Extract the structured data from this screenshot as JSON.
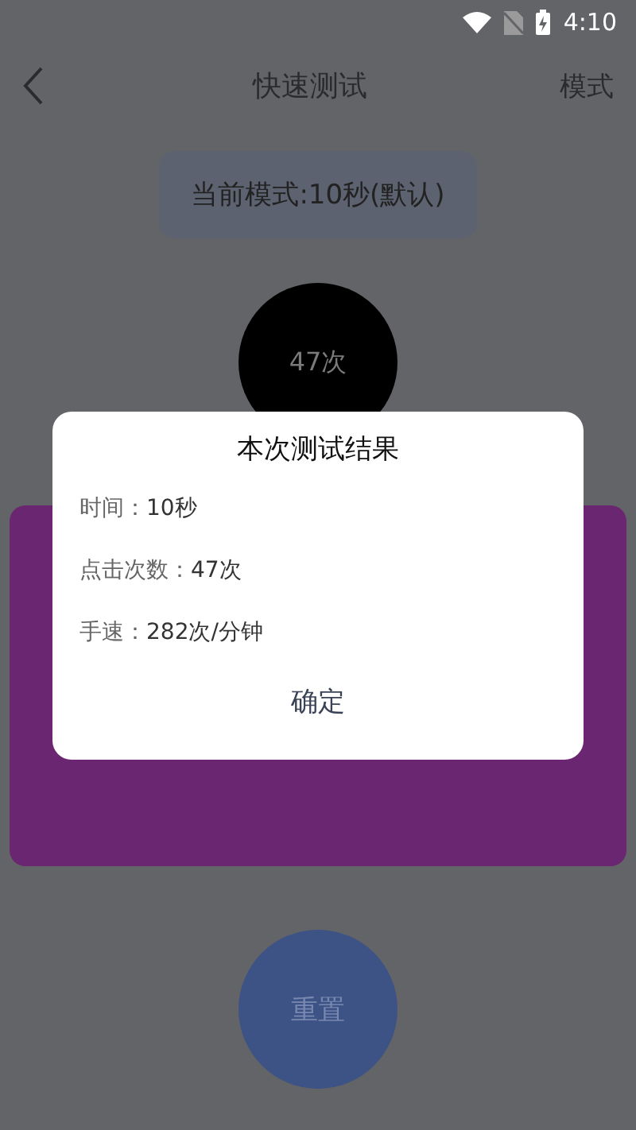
{
  "status_bar": {
    "time": "4:10"
  },
  "nav": {
    "title": "快速测试",
    "action": "模式"
  },
  "mode_label": "当前模式:10秒(默认)",
  "tap_button": {
    "count": "47次"
  },
  "reset_button": "重置",
  "dialog": {
    "title": "本次测试结果",
    "rows": [
      {
        "label": "时间：",
        "value": "10秒"
      },
      {
        "label": "点击次数：",
        "value": "47次"
      },
      {
        "label": "手速：",
        "value": "282次/分钟"
      }
    ],
    "confirm": "确定"
  }
}
